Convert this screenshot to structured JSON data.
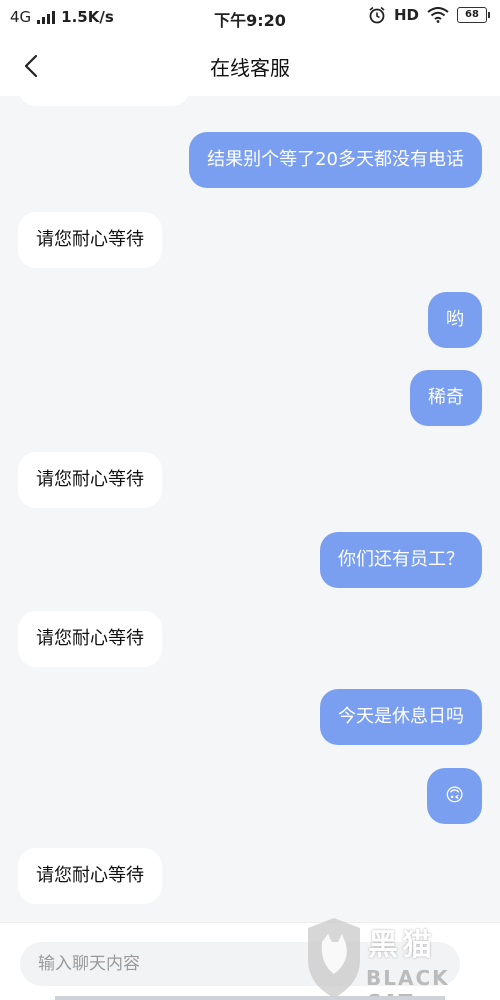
{
  "status_bar": {
    "network": "4G",
    "speed": "1.5K/s",
    "time": "下午9:20",
    "hd": "HD",
    "battery": "68"
  },
  "header": {
    "title": "在线客服"
  },
  "messages": [
    {
      "side": "right",
      "text": "结果别个等了20多天都没有电话"
    },
    {
      "side": "left",
      "text": "请您耐心等待"
    },
    {
      "side": "right",
      "text": "哟"
    },
    {
      "side": "right",
      "text": "稀奇"
    },
    {
      "side": "left",
      "text": "请您耐心等待"
    },
    {
      "side": "right",
      "text": "你们还有员工？"
    },
    {
      "side": "left",
      "text": "请您耐心等待"
    },
    {
      "side": "right",
      "text": "今天是休息日吗"
    },
    {
      "side": "right",
      "text": "🙃"
    },
    {
      "side": "left",
      "text": "请您耐心等待"
    }
  ],
  "input": {
    "placeholder": "输入聊天内容"
  },
  "watermark": {
    "logo": "黑猫",
    "sub": "BLACK CAT"
  },
  "colors": {
    "user_bubble": "#7a9ff0",
    "agent_bubble": "#ffffff",
    "background": "#f5f6f8"
  }
}
